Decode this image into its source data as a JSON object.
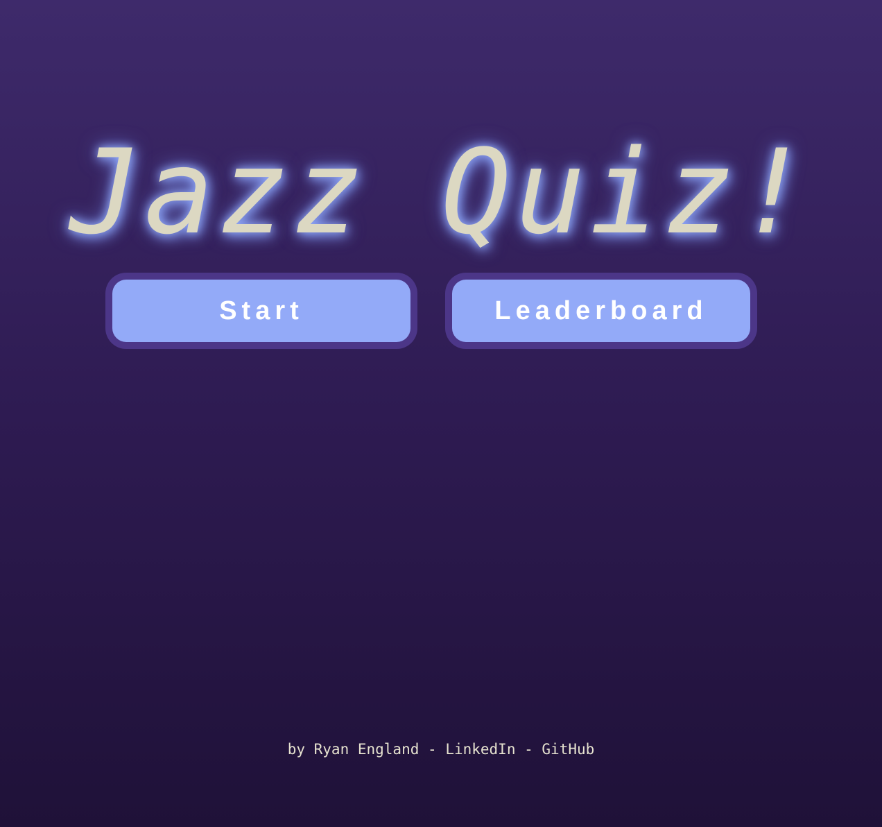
{
  "title": "Jazz Quiz!",
  "buttons": {
    "start_label": "Start",
    "leaderboard_label": "Leaderboard"
  },
  "footer": {
    "credit": "by Ryan England",
    "separator": " - ",
    "linkedin_label": "LinkedIn",
    "github_label": "GitHub"
  },
  "colors": {
    "background_top": "#3e2a6b",
    "background_bottom": "#1f1138",
    "title_text": "#dcd8c2",
    "title_glow": "#96afff",
    "button_fill": "#93aaf8",
    "button_border": "#4c3688",
    "button_text": "#ffffff",
    "footer_text": "#e6e2cf"
  }
}
